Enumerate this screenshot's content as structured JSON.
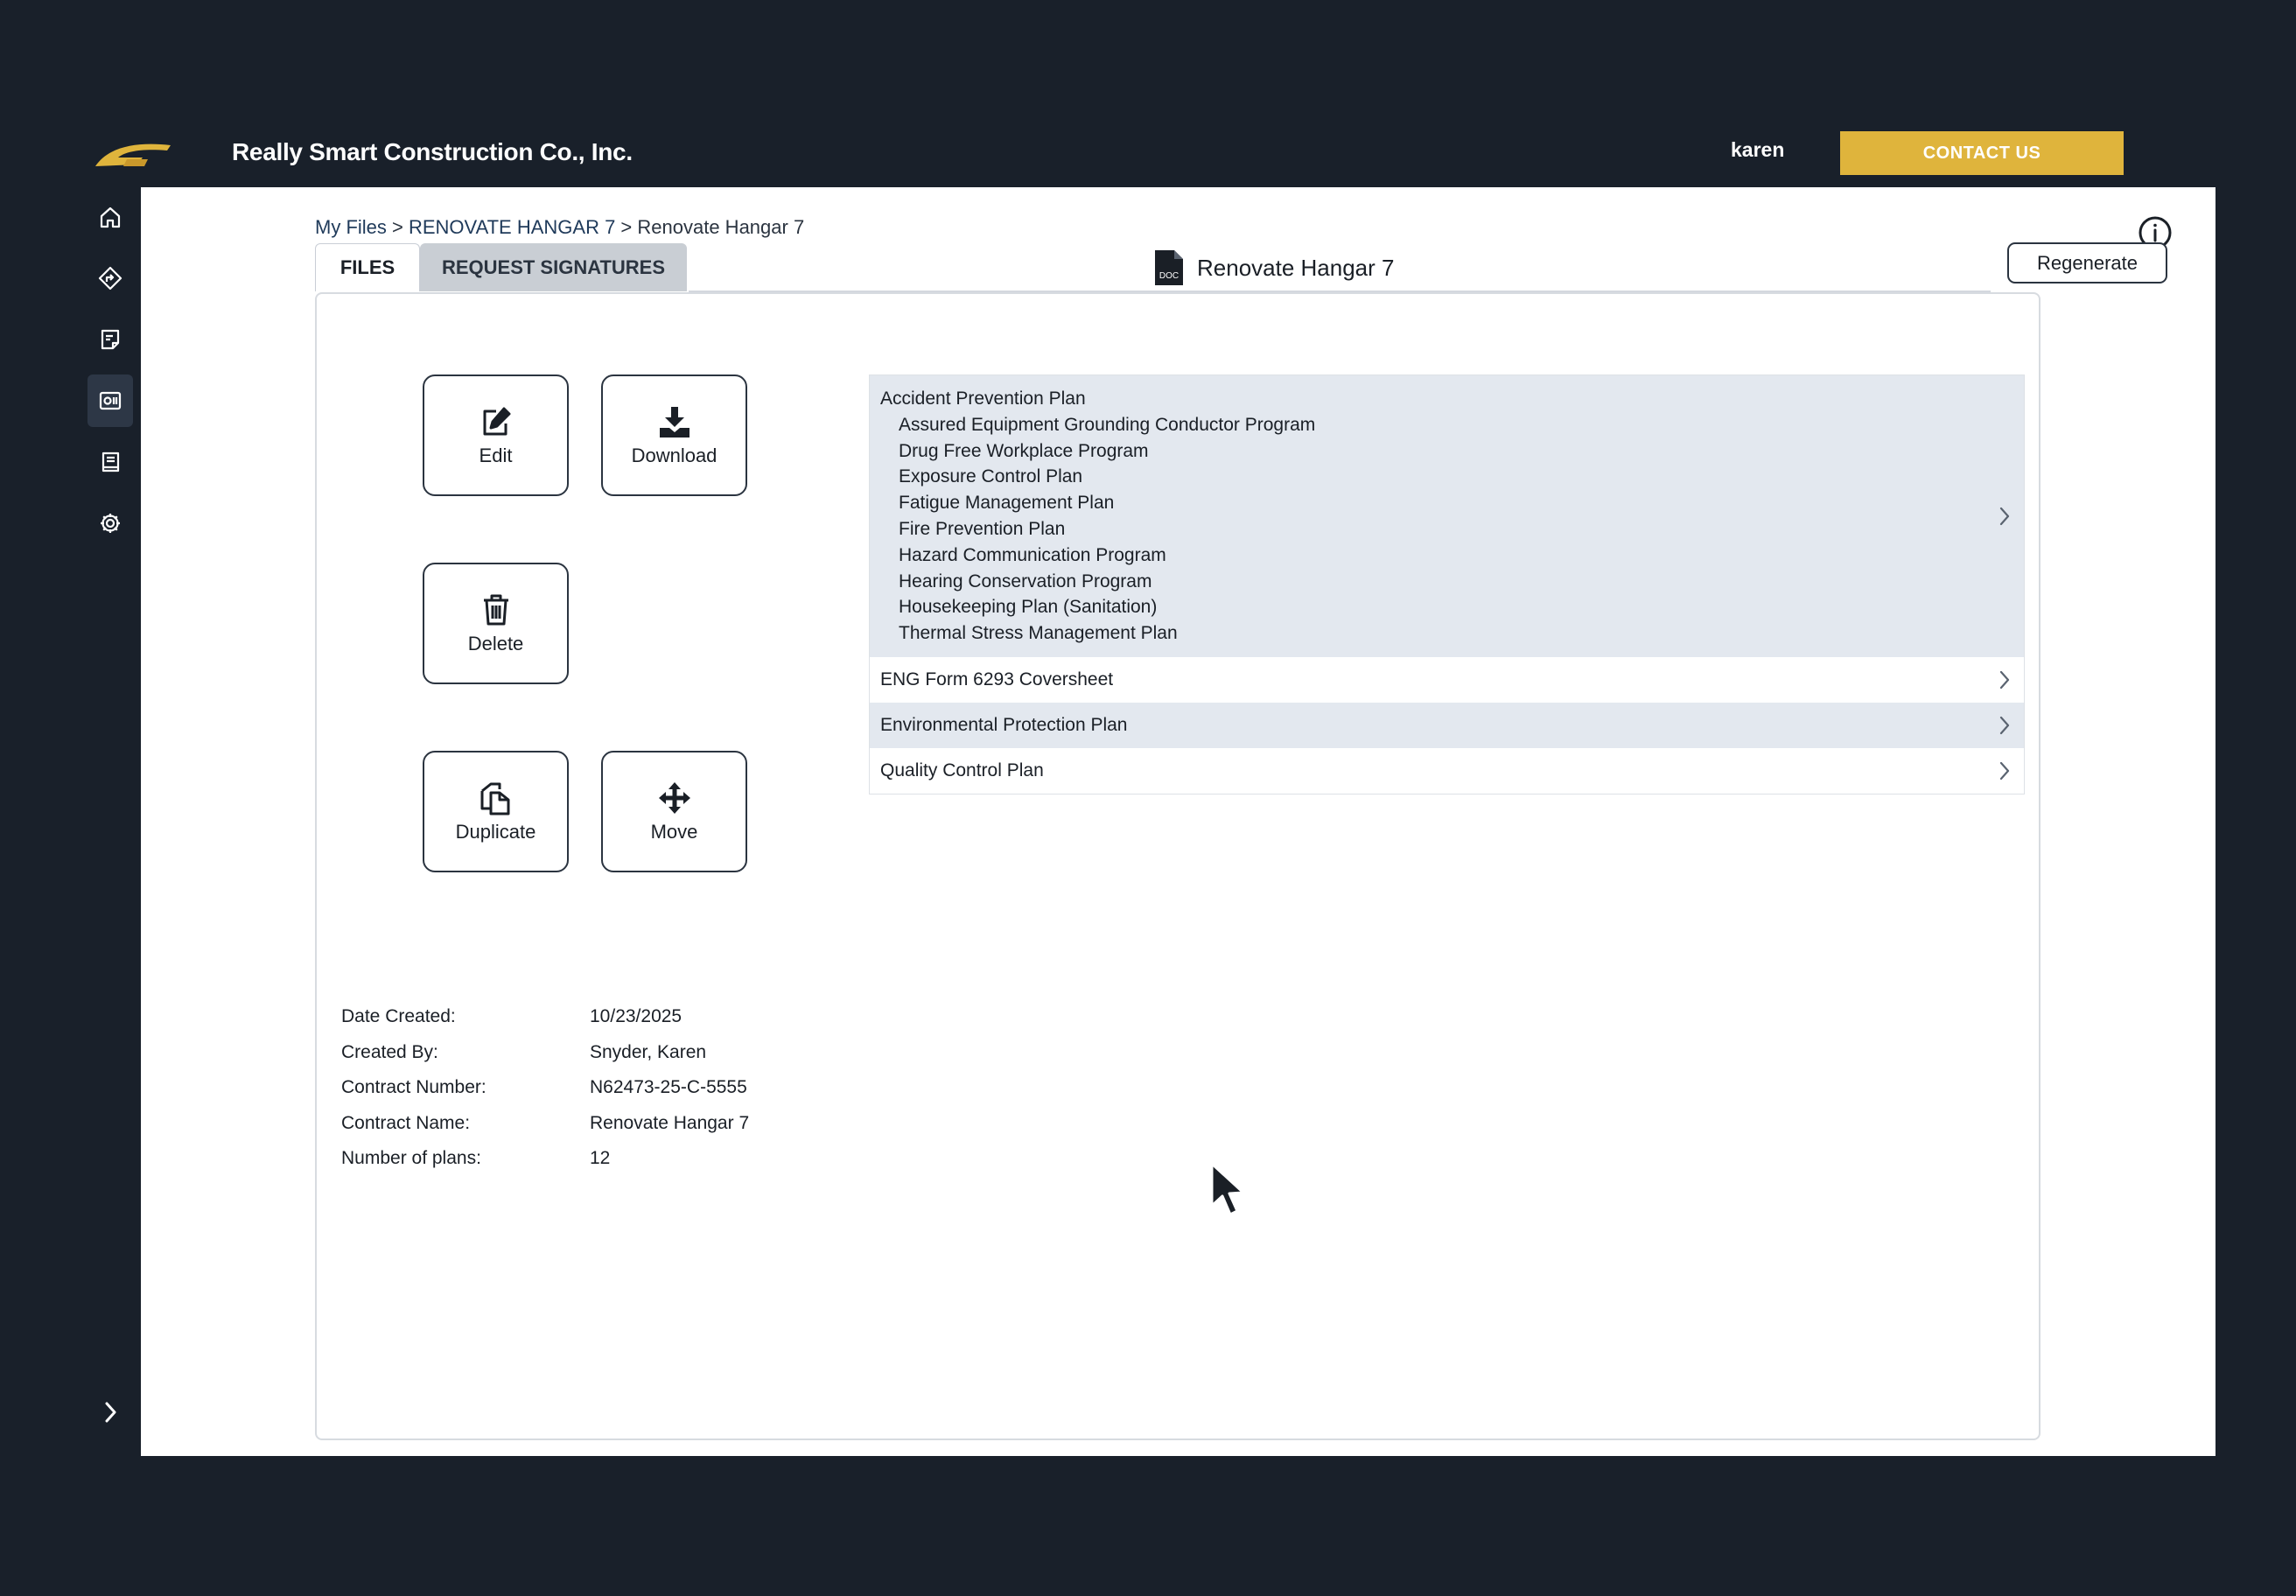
{
  "header": {
    "company_name": "Really Smart Construction Co., Inc.",
    "username": "karen",
    "contact_label": "CONTACT US",
    "accent_color": "#dfb43c"
  },
  "sidebar": {
    "items": [
      {
        "icon": "home-icon",
        "active": false
      },
      {
        "icon": "diamond-arrow-icon",
        "active": false
      },
      {
        "icon": "notes-icon",
        "active": false
      },
      {
        "icon": "id-card-icon",
        "active": true
      },
      {
        "icon": "book-icon",
        "active": false
      },
      {
        "icon": "gear-icon",
        "active": false
      }
    ],
    "expand_icon": "chevron-right-icon"
  },
  "breadcrumb": {
    "root": "My Files",
    "sep1": " > ",
    "folder": "RENOVATE HANGAR 7",
    "sep2": " > ",
    "current": "Renovate Hangar 7"
  },
  "tabs": {
    "files": "FILES",
    "request_signatures": "REQUEST SIGNATURES"
  },
  "document": {
    "icon_label": "DOC",
    "title": "Renovate Hangar 7"
  },
  "regenerate_label": "Regenerate",
  "actions": {
    "edit": "Edit",
    "download": "Download",
    "delete": "Delete",
    "duplicate": "Duplicate",
    "move": "Move"
  },
  "details": [
    {
      "label": "Date Created:",
      "value": "10/23/2025"
    },
    {
      "label": "Created By:",
      "value": "Snyder, Karen"
    },
    {
      "label": "Contract Number:",
      "value": "N62473-25-C-5555"
    },
    {
      "label": "Contract Name:",
      "value": "Renovate Hangar 7"
    },
    {
      "label": "Number of plans:",
      "value": "12"
    }
  ],
  "plans": {
    "group_title": "Accident Prevention Plan",
    "sub_items": [
      "Assured Equipment Grounding Conductor Program",
      "Drug Free Workplace Program",
      "Exposure Control Plan",
      "Fatigue Management Plan",
      "Fire Prevention Plan",
      "Hazard Communication Program",
      "Hearing Conservation Program",
      "Housekeeping Plan (Sanitation)",
      "Thermal Stress Management Plan"
    ],
    "rows": [
      "ENG Form 6293 Coversheet",
      "Environmental Protection Plan",
      "Quality Control Plan"
    ]
  }
}
